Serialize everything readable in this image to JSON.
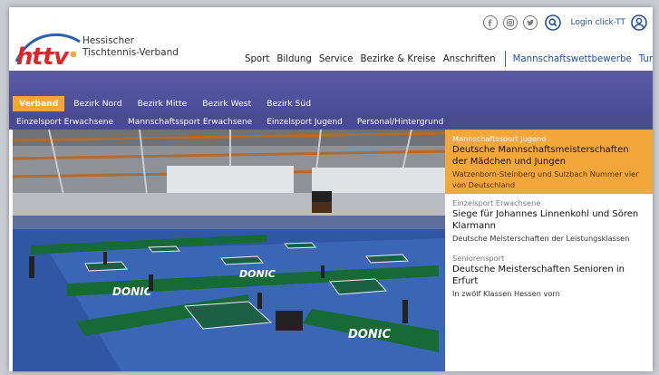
{
  "header": {
    "org_line1": "Hessischer",
    "org_line2": "Tischtennis-Verband",
    "social_icons": [
      "facebook-icon",
      "instagram-icon",
      "twitter-icon"
    ],
    "login_label": "Login click-TT",
    "main_nav": [
      "Sport",
      "Bildung",
      "Service",
      "Bezirke & Kreise",
      "Anschriften"
    ],
    "main_nav_highlight": [
      "Mannschaftswettbewerbe",
      "Turniere"
    ]
  },
  "subnav": {
    "tabs": [
      "Verband",
      "Bezirk Nord",
      "Bezirk Mitte",
      "Bezirk West",
      "Bezirk Süd"
    ],
    "active": "Verband",
    "second_row": [
      "Einzelsport Erwachsene",
      "Mannschaftssport Erwachsene",
      "Einzelsport Jugend",
      "Personal/Hintergrund"
    ]
  },
  "news": [
    {
      "category": "Mannschaftssport Jugend",
      "title": "Deutsche Mannschaftsmeisterschaften der Mädchen und Jungen",
      "subtitle": "Watzenborn-Steinberg und Sulzbach Nummer vier von Deutschland"
    },
    {
      "category": "Einzelsport Erwachsene",
      "title": "Siege für Johannes Linnenkohl und Sören Klarmann",
      "subtitle": "Deutsche Meisterschaften der Leistungsklassen"
    },
    {
      "category": "Seniorensport",
      "title": "Deutsche Meisterschaften Senioren in Erfurt",
      "subtitle": "In zwölf Klassen Hessen vorn"
    }
  ],
  "hero": {
    "banner_text": "DONIC"
  },
  "colors": {
    "accent": "#f3a73a",
    "band": "#4d4f99",
    "link_blue": "#1f4fa0",
    "logo_red": "#e0242a"
  }
}
